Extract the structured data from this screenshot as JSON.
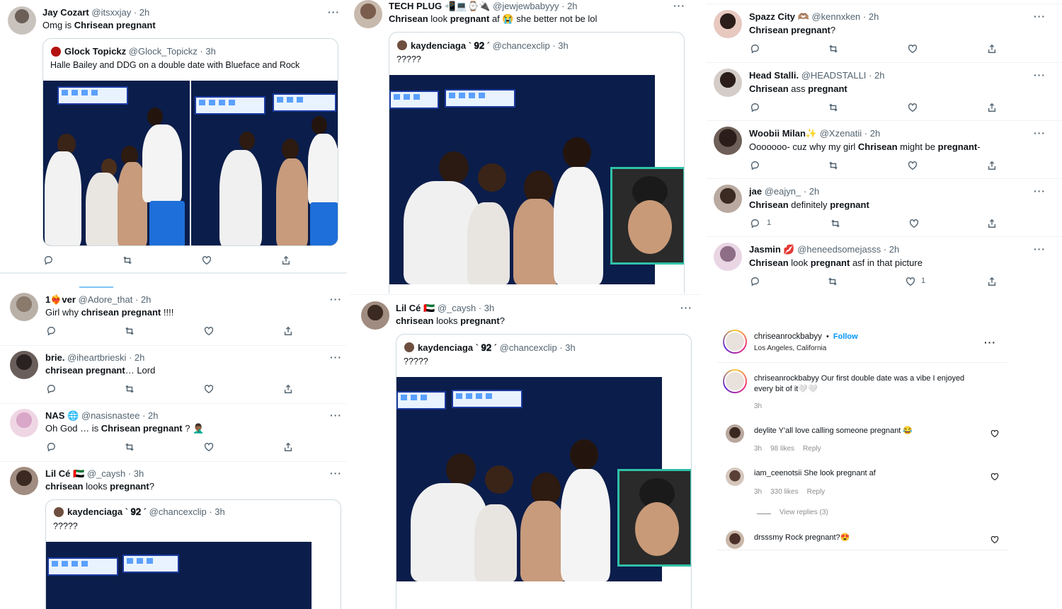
{
  "left": {
    "tweets": [
      {
        "name": "Jay Cozart",
        "handle": "@itsxxjay",
        "time": " · 2h",
        "text_pre": "Omg is ",
        "text_bold": "Chrisean pregnant",
        "text_post": "",
        "quote": {
          "name": "Glock Topickz",
          "handle": "@Glock_Topickz",
          "time": " · 3h",
          "text": "Halle Bailey and DDG on a double date with Blueface and Rock"
        }
      },
      {
        "name": "1❤️‍🔥ver",
        "handle": "@Adore_that",
        "time": " · 2h",
        "text_pre": "Girl why ",
        "text_bold": "chrisean pregnant",
        "text_post": " !!!!"
      },
      {
        "name": "brie.",
        "handle": "@iheartbrieski",
        "time": " · 2h",
        "text_pre": "",
        "text_bold": "chrisean pregnant",
        "text_post": "… Lord"
      },
      {
        "name": "NAS 🌐",
        "handle": "@nasisnastee",
        "time": " · 2h",
        "text_pre": "Oh God … is ",
        "text_bold": "Chrisean pregnant",
        "text_post": " ? 🤦🏾‍♂️"
      },
      {
        "name": "Lil Cé 🇦🇪",
        "handle": "@_caysh",
        "time": " · 3h",
        "text_pre": "",
        "text_bold": "chrisean",
        "text_post": " looks ",
        "text_bold2": "pregnant",
        "text_post2": "?",
        "quote": {
          "name": "kaydenciaga ` 𝟗𝟐 ´",
          "handle": "@chancexclip",
          "time": " · 3h",
          "text": "?????"
        }
      }
    ]
  },
  "middle": {
    "tweets": [
      {
        "name": "TECH PLUG 📲💻⌚🔌",
        "handle": "@jewjewbabyyy",
        "time": " · 2h",
        "text_bold": "Chrisean",
        "text_mid": " look ",
        "text_bold2": "pregnant",
        "text_post": " af 😭 she better not be lol",
        "quote": {
          "name": "kaydenciaga ` 𝟗𝟐 ´",
          "handle": "@chancexclip",
          "time": " · 3h",
          "text": "?????"
        }
      },
      {
        "name": "Lil Cé 🇦🇪",
        "handle": "@_caysh",
        "time": " · 3h",
        "text_bold": "chrisean",
        "text_mid": " looks ",
        "text_bold2": "pregnant",
        "text_post": "?",
        "quote": {
          "name": "kaydenciaga ` 𝟗𝟐 ´",
          "handle": "@chancexclip",
          "time": " · 3h",
          "text": "?????"
        }
      }
    ]
  },
  "right": {
    "tweets": [
      {
        "name": "Spazz City 🫶🏽",
        "handle": "@kennxken",
        "time": " · 2h",
        "text_bold": "Chrisean pregnant",
        "text_post": "?",
        "like_count": "",
        "reply_count": ""
      },
      {
        "name": "Head Stalli.",
        "handle": "@HEADSTALLI",
        "time": " · 2h",
        "text_bold": "Chrisean",
        "text_mid": " ass ",
        "text_bold2": "pregnant",
        "text_post": "",
        "like_count": "",
        "reply_count": ""
      },
      {
        "name": "Woobii Milan✨",
        "handle": "@Xzenatii",
        "time": " · 2h",
        "text_pre": "Ooooooo- cuz why my girl ",
        "text_bold": "Chrisean",
        "text_mid": " might be ",
        "text_bold2": "pregnant",
        "text_post": "-",
        "like_count": "",
        "reply_count": ""
      },
      {
        "name": "jae",
        "handle": "@eajyn_",
        "time": " · 2h",
        "text_bold": "Chrisean",
        "text_mid": " definitely ",
        "text_bold2": "pregnant",
        "text_post": "",
        "like_count": "",
        "reply_count": "1"
      },
      {
        "name": "Jasmin 💋",
        "handle": "@heneedsomejasss",
        "time": " · 2h",
        "text_bold": "Chrisean",
        "text_mid": " look ",
        "text_bold2": "pregnant",
        "text_post": " asf in that picture",
        "like_count": "1",
        "reply_count": ""
      }
    ],
    "instagram": {
      "username": "chriseanrockbabyy",
      "dot": "•",
      "follow": "Follow",
      "location": "Los Angeles, California",
      "caption_user": "chriseanrockbabyy",
      "caption_line1": "Our first double date was a vibe I enjoyed",
      "caption_line2": "every bit of it🤍🤍",
      "caption_time": "3h",
      "comments": [
        {
          "user": "deylite",
          "text": "Y'all love calling someone pregnant 😂",
          "time": "3h",
          "likes": "98 likes",
          "reply": "Reply"
        },
        {
          "user": "iam_ceenotsii",
          "text": "She look pregnant af",
          "time": "3h",
          "likes": "330 likes",
          "reply": "Reply"
        },
        {
          "user": "drsssmy",
          "text": "Rock pregnant?😍",
          "time": "",
          "likes": "",
          "reply": ""
        }
      ],
      "view_replies": "View replies (3)"
    }
  },
  "colors": {
    "accent": "#1d9bf0",
    "muted": "#536471",
    "border": "#cfd9de",
    "inset_border": "#2fc1a8"
  }
}
